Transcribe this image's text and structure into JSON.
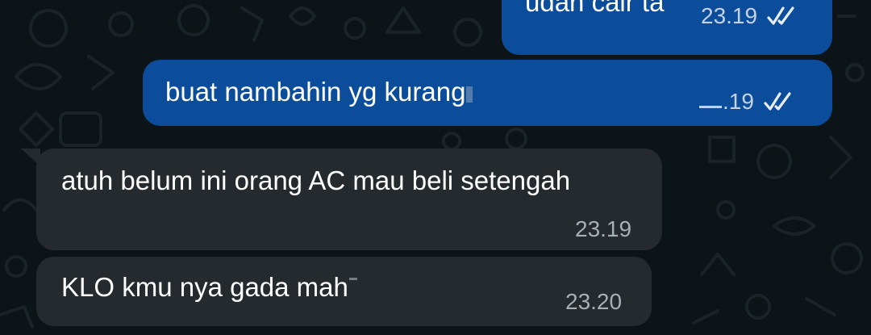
{
  "chat": {
    "messages": [
      {
        "direction": "outgoing",
        "text": "udah cair ta",
        "time": "23.19",
        "status": "read-double-check-icon"
      },
      {
        "direction": "outgoing",
        "text": "buat nambahin yg kurang",
        "time": ".19",
        "status": "read-double-check-icon"
      },
      {
        "direction": "incoming",
        "text": "atuh belum ini orang AC mau beli setengah",
        "time": "23.19"
      },
      {
        "direction": "incoming",
        "text": "KLO kmu nya gada mah",
        "time": "23.20"
      }
    ]
  },
  "colors": {
    "background": "#0d1418",
    "outgoing_bubble": "#0b4d9b",
    "incoming_bubble": "#242a2e",
    "text": "#ffffff"
  }
}
